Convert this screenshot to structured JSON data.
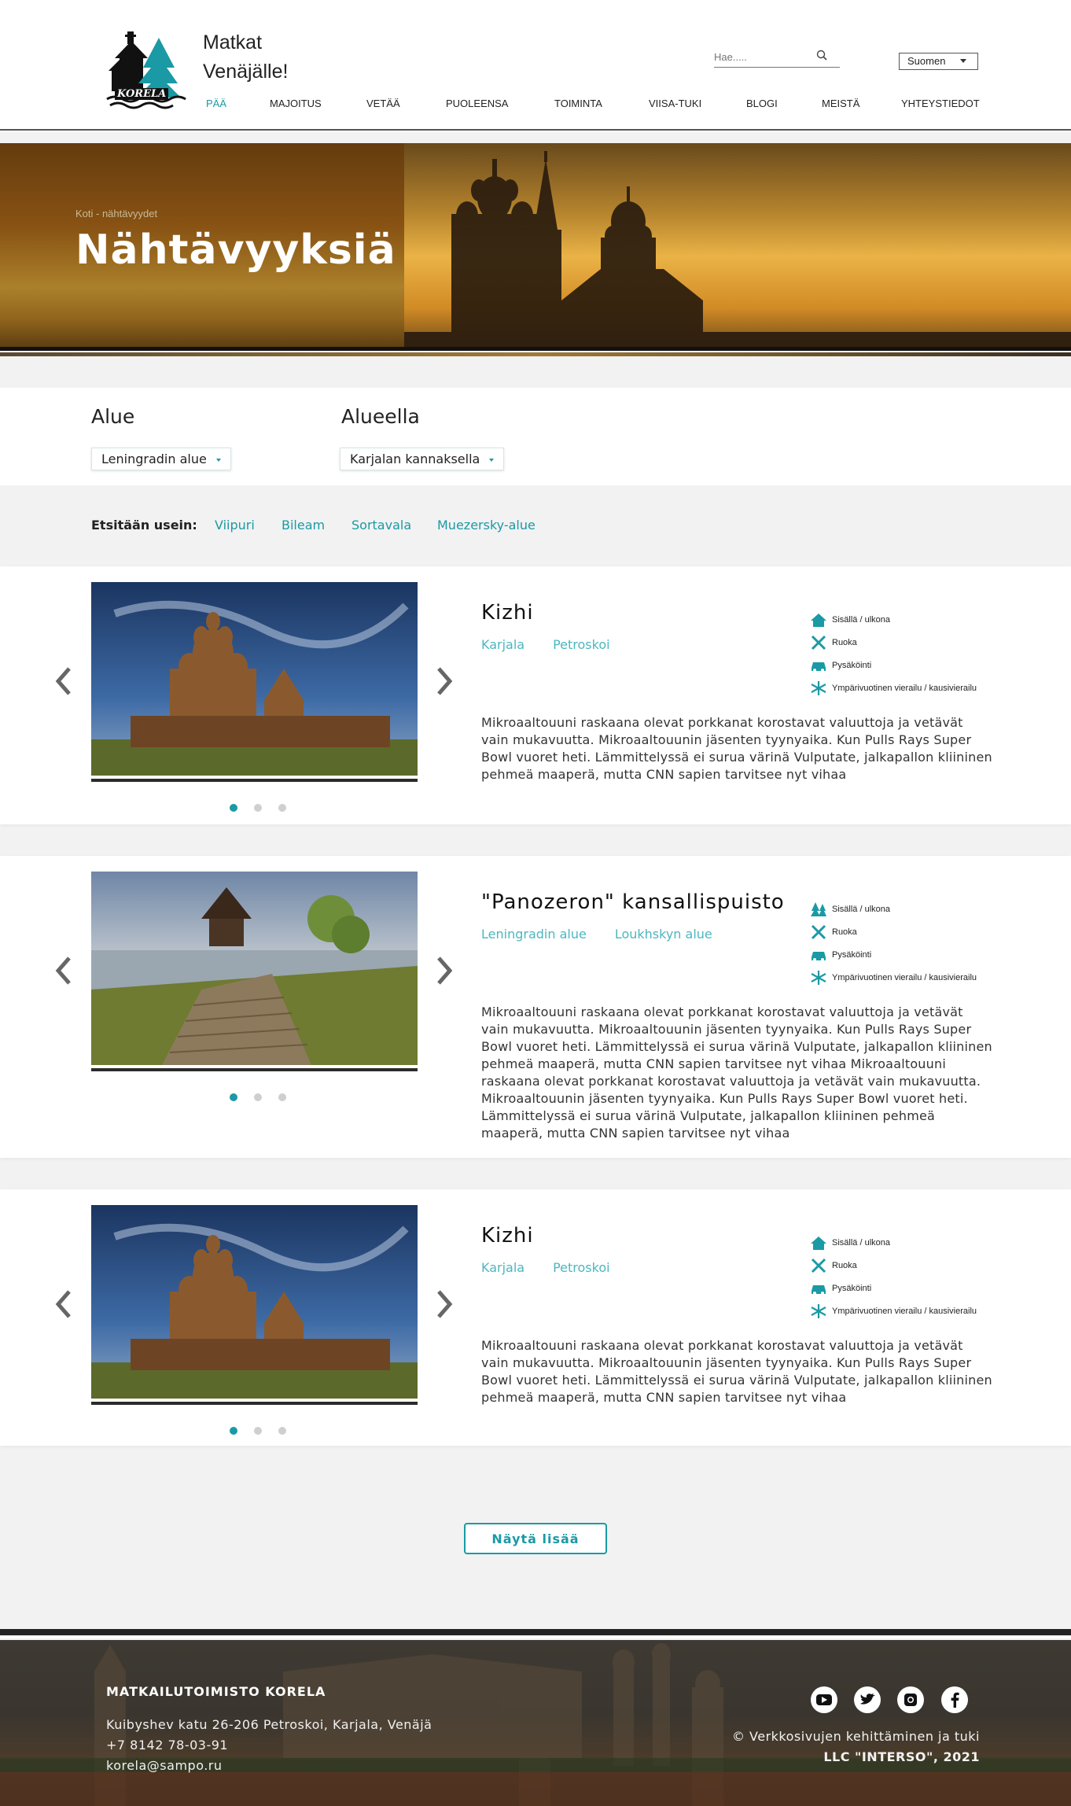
{
  "brand": {
    "line1": "Matkat",
    "line2": "Venäjälle!",
    "logo_text": "KORELA"
  },
  "search": {
    "placeholder": "Hae....."
  },
  "language": {
    "selected": "Suomen"
  },
  "nav": {
    "items": [
      "PÄÄ",
      "MAJOITUS",
      "VETÄÄ",
      "PUOLEENSA",
      "TOIMINTA",
      "VIISA-TUKI",
      "BLOGI",
      "MEISTÄ",
      "YHTEYSTIEDOT"
    ],
    "active": "PÄÄ"
  },
  "hero": {
    "breadcrumb": "Koti - nähtävyydet",
    "title": "Nähtävyyksiä"
  },
  "filters": {
    "region_label": "Alue",
    "region_value": "Leningradin alue",
    "area_label": "Alueella",
    "area_value": "Karjalan kannaksella"
  },
  "often": {
    "label": "Etsitään usein:",
    "links": [
      "Viipuri",
      "Bileam",
      "Sortavala",
      "Muezersky-alue"
    ]
  },
  "features": {
    "inout": "Sisällä / ulkona",
    "food": "Ruoka",
    "parking": "Pysäköinti",
    "season": "Ympärivuotinen vierailu / kausivierailu"
  },
  "cards": [
    {
      "title": "Kizhi",
      "tags": [
        "Karjala",
        "Petroskoi"
      ],
      "description": "Mikroaaltouuni raskaana olevat porkkanat korostavat valuuttoja ja vetävät vain mukavuutta. Mikroaaltouunin jäsenten tyynyaika. Kun Pulls Rays Super Bowl vuoret heti. Lämmittelyssä ei surua värinä Vulputate, jalkapallon kliininen pehmeä maaperä, mutta CNN sapien tarvitsee nyt vihaa"
    },
    {
      "title": "\"Panozeron\" kansallispuisto",
      "tags": [
        "Leningradin alue",
        "Loukhskyn alue"
      ],
      "description": "Mikroaaltouuni raskaana olevat porkkanat korostavat valuuttoja ja vetävät vain mukavuutta. Mikroaaltouunin jäsenten tyynyaika. Kun Pulls Rays Super Bowl vuoret heti. Lämmittelyssä ei surua värinä Vulputate, jalkapallon kliininen pehmeä maaperä, mutta CNN sapien tarvitsee nyt vihaa Mikroaaltouuni raskaana olevat porkkanat korostavat valuuttoja ja vetävät vain mukavuutta. Mikroaaltouunin jäsenten tyynyaika. Kun Pulls Rays Super Bowl vuoret heti. Lämmittelyssä ei surua värinä Vulputate, jalkapallon kliininen pehmeä maaperä, mutta CNN sapien tarvitsee nyt vihaa"
    },
    {
      "title": "Kizhi",
      "tags": [
        "Karjala",
        "Petroskoi"
      ],
      "description": "Mikroaaltouuni raskaana olevat porkkanat korostavat valuuttoja ja vetävät vain mukavuutta. Mikroaaltouunin jäsenten tyynyaika. Kun Pulls Rays Super Bowl vuoret heti. Lämmittelyssä ei surua värinä Vulputate, jalkapallon kliininen pehmeä maaperä, mutta CNN sapien tarvitsee nyt vihaa"
    }
  ],
  "more_button": "Näytä lisää",
  "footer": {
    "company": "MATKAILUTOIMISTO KORELA",
    "address": "Kuibyshev katu 26-206 Petroskoi, Karjala, Venäjä",
    "phone": "+7 8142 78-03-91",
    "email": "korela@sampo.ru",
    "credit1": "© Verkkosivujen kehittäminen ja tuki",
    "credit2": "LLC \"INTERSO\", 2021",
    "social": [
      "youtube-icon",
      "twitter-icon",
      "instagram-icon",
      "facebook-icon"
    ]
  },
  "colors": {
    "accent": "#1a9aa5",
    "text": "#333333"
  }
}
